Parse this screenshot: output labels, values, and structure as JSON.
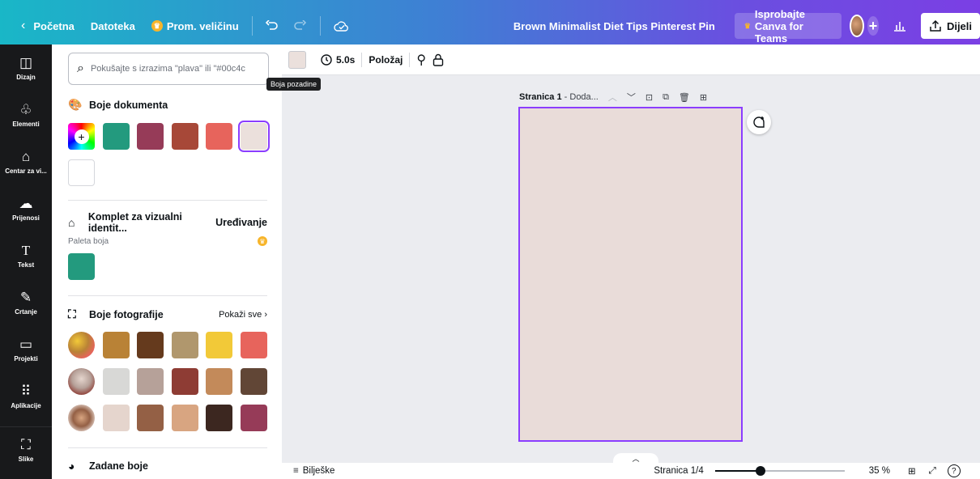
{
  "topbar": {
    "back_label": "Početna",
    "file_label": "Datoteka",
    "resize_label": "Prom. veličinu",
    "doc_title": "Brown Minimalist Diet Tips Pinterest Pin",
    "teams_label": "Isprobajte Canva for Teams",
    "share_label": "Dijeli",
    "accent": "#8b3dff"
  },
  "rail": {
    "items": [
      {
        "label": "Dizajn",
        "icon": "layout-icon"
      },
      {
        "label": "Elementi",
        "icon": "shapes-icon"
      },
      {
        "label": "Centar za vi...",
        "icon": "brand-hub-icon"
      },
      {
        "label": "Prijenosi",
        "icon": "upload-cloud-icon"
      },
      {
        "label": "Tekst",
        "icon": "text-icon"
      },
      {
        "label": "Crtanje",
        "icon": "draw-icon"
      },
      {
        "label": "Projekti",
        "icon": "folder-icon"
      },
      {
        "label": "Aplikacije",
        "icon": "apps-grid-icon"
      },
      {
        "label": "Slike",
        "icon": "image-icon"
      }
    ]
  },
  "panel": {
    "search_placeholder": "Pokušajte s izrazima \"plava\" ili \"#00c4c",
    "doc_colors_title": "Boje dokumenta",
    "doc_colors": [
      "#239a7e",
      "#963b58",
      "#a74838",
      "#e7645c",
      "#ebe0dc",
      "#ffffff"
    ],
    "brand_kit_title": "Komplet za vizualni identit...",
    "brand_kit_edit": "Uređivanje",
    "palette_label": "Paleta boja",
    "palette_colors": [
      "#239a7e"
    ],
    "photo_colors_title": "Boje fotografije",
    "photo_colors_show_all": "Pokaži sve",
    "photo_rows": [
      [
        "#b98236",
        "#653a1d",
        "#b0976d",
        "#f2c938",
        "#e7645c"
      ],
      [
        "#d8d8d6",
        "#b6a199",
        "#8e3c34",
        "#c38a5a",
        "#614636"
      ],
      [
        "#e5d5cd",
        "#946045",
        "#d8a581",
        "#3c2720",
        "#963b58"
      ]
    ],
    "default_colors_title": "Zadane boje"
  },
  "toolbar": {
    "duration": "5.0s",
    "position_label": "Položaj",
    "tooltip": "Boja pozadine",
    "bg_color": "#ebe0dc"
  },
  "canvas": {
    "page_label": "Stranica 1",
    "page_title_placeholder": "- Doda...",
    "page_color": "#e9dcd9"
  },
  "bottombar": {
    "notes_label": "Bilješke",
    "page_counter": "Stranica 1/4",
    "zoom_fraction": 0.35,
    "zoom_label": "35 %"
  }
}
